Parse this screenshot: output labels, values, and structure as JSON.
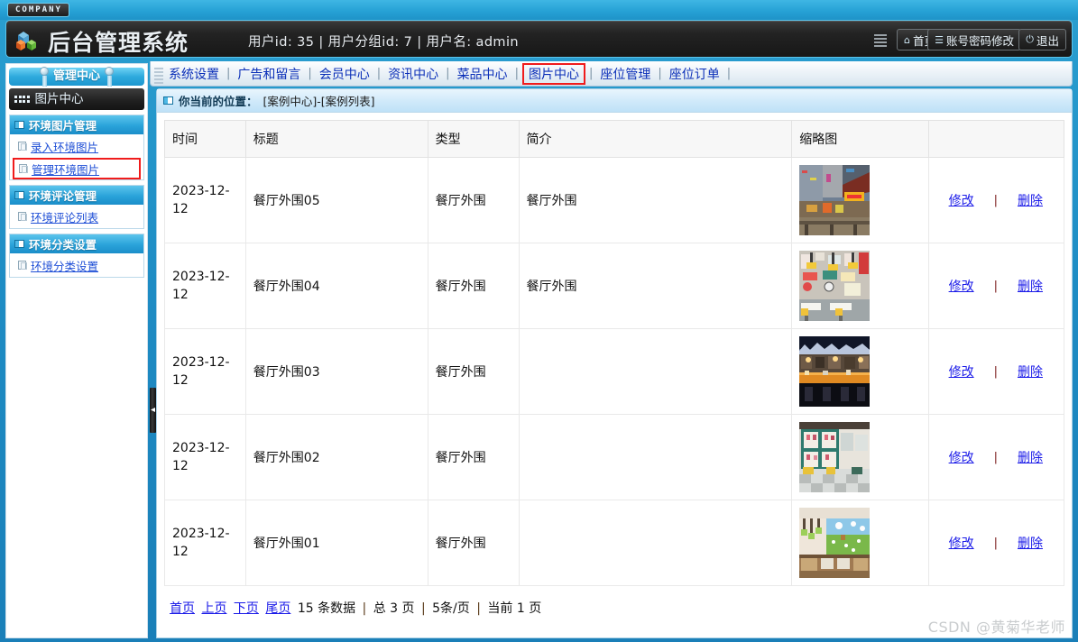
{
  "brand": {
    "badge": "COMPANY",
    "app_title": "后台管理系统"
  },
  "header": {
    "user_info": "用户id: 35 | 用户分组id: 7 | 用户名: admin",
    "buttons": [
      {
        "icon": "home-icon",
        "glyph": "⌂",
        "label": "首页"
      },
      {
        "icon": "document-icon",
        "glyph": "☰",
        "label": "账号密码修改"
      },
      {
        "icon": "power-icon",
        "glyph": "⏻",
        "label": "退出"
      }
    ]
  },
  "nav": {
    "items": [
      {
        "label": "系统设置",
        "active": false
      },
      {
        "label": "广告和留言",
        "active": false
      },
      {
        "label": "会员中心",
        "active": false
      },
      {
        "label": "资讯中心",
        "active": false
      },
      {
        "label": "菜品中心",
        "active": false
      },
      {
        "label": "图片中心",
        "active": true
      },
      {
        "label": "座位管理",
        "active": false
      },
      {
        "label": "座位订单",
        "active": false
      }
    ],
    "separator": "|",
    "active_border_color": "#f01c1c"
  },
  "sidebar": {
    "title": "管理中心",
    "subtitle": "图片中心",
    "groups": [
      {
        "title": "环境图片管理",
        "items": [
          {
            "label": "录入环境图片",
            "marked": false
          },
          {
            "label": "管理环境图片",
            "marked": true
          }
        ]
      },
      {
        "title": "环境评论管理",
        "items": [
          {
            "label": "环境评论列表",
            "marked": false
          }
        ]
      },
      {
        "title": "环境分类设置",
        "items": [
          {
            "label": "环境分类设置",
            "marked": false
          }
        ]
      }
    ]
  },
  "breadcrumb": {
    "label": "你当前的位置：",
    "path": "[案例中心]-[案例列表]"
  },
  "table": {
    "columns": [
      "时间",
      "标题",
      "类型",
      "简介",
      "缩略图",
      ""
    ],
    "rows": [
      {
        "time": "2023-12-12",
        "title": "餐厅外围05",
        "type": "餐厅外围",
        "intro": "餐厅外围",
        "thumb": "restaurant-street-photo",
        "edit": "修改",
        "sep": "|",
        "delete": "删除"
      },
      {
        "time": "2023-12-12",
        "title": "餐厅外围04",
        "type": "餐厅外围",
        "intro": "餐厅外围",
        "thumb": "restaurant-interior-signs-photo",
        "edit": "修改",
        "sep": "|",
        "delete": "删除"
      },
      {
        "time": "2023-12-12",
        "title": "餐厅外围03",
        "type": "餐厅外围",
        "intro": "",
        "thumb": "restaurant-bar-counter-photo",
        "edit": "修改",
        "sep": "|",
        "delete": "删除"
      },
      {
        "time": "2023-12-12",
        "title": "餐厅外围02",
        "type": "餐厅外围",
        "intro": "",
        "thumb": "restaurant-green-shelves-photo",
        "edit": "修改",
        "sep": "|",
        "delete": "删除"
      },
      {
        "time": "2023-12-12",
        "title": "餐厅外围01",
        "type": "餐厅外围",
        "intro": "",
        "thumb": "restaurant-mural-booths-photo",
        "edit": "修改",
        "sep": "|",
        "delete": "删除"
      }
    ]
  },
  "pager": {
    "first": "首页",
    "prev": "上页",
    "next": "下页",
    "last": "尾页",
    "total_records": "15 条数据",
    "sep1": "|",
    "total_pages": "总 3 页",
    "sep2": "|",
    "page_size": "5条/页",
    "sep3": "|",
    "current_page": "当前 1 页"
  },
  "watermark": "CSDN @黄菊华老师"
}
